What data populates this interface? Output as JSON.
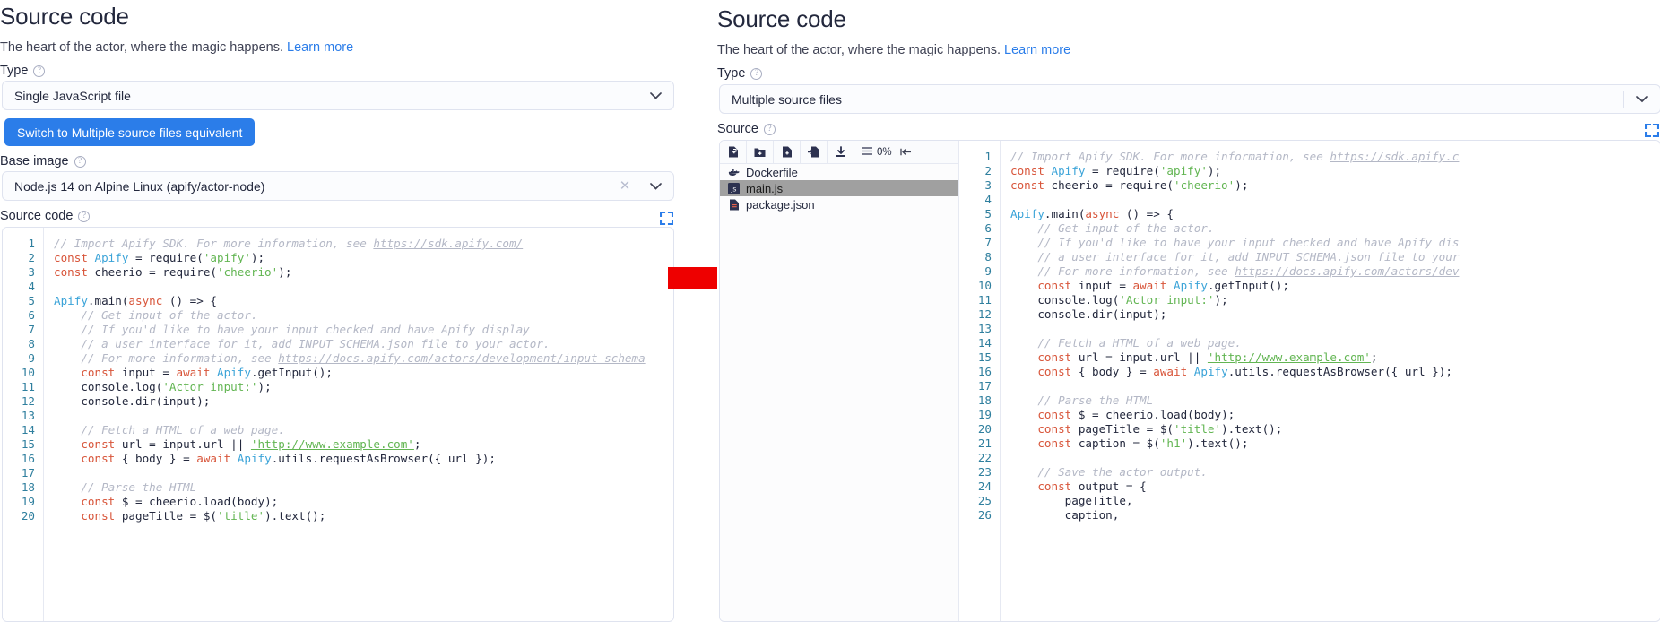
{
  "arrow": {
    "name": "red-right-arrow",
    "color": "#ee0000"
  },
  "left_panel": {
    "title": "Source code",
    "subtitle": "The heart of the actor, where the magic happens.",
    "learn_more": "Learn more",
    "type_label": "Type",
    "type_value": "Single JavaScript file",
    "switch_button": "Switch to Multiple source files equivalent",
    "base_image_label": "Base image",
    "base_image_value": "Node.js 14 on Alpine Linux (apify/actor-node)",
    "source_code_label": "Source code",
    "help_glyph": "?",
    "expand_icon": "expand-icon",
    "code": {
      "first_line": 1,
      "lines": [
        [
          {
            "t": "cmt",
            "v": "// Import Apify SDK. For more information, see "
          },
          {
            "t": "url",
            "v": "https://sdk.apify.com/"
          }
        ],
        [
          {
            "t": "kw",
            "v": "const"
          },
          {
            "t": "txt",
            "v": " "
          },
          {
            "t": "cls",
            "v": "Apify"
          },
          {
            "t": "txt",
            "v": " = require("
          },
          {
            "t": "str",
            "v": "'apify'"
          },
          {
            "t": "txt",
            "v": ");"
          }
        ],
        [
          {
            "t": "kw",
            "v": "const"
          },
          {
            "t": "txt",
            "v": " cheerio = require("
          },
          {
            "t": "str",
            "v": "'cheerio'"
          },
          {
            "t": "txt",
            "v": ");"
          }
        ],
        [],
        [
          {
            "t": "cls",
            "v": "Apify"
          },
          {
            "t": "txt",
            "v": ".main("
          },
          {
            "t": "kw",
            "v": "async"
          },
          {
            "t": "txt",
            "v": " () => {"
          }
        ],
        [
          {
            "t": "cmt",
            "v": "    // Get input of the actor."
          }
        ],
        [
          {
            "t": "cmt",
            "v": "    // If you'd like to have your input checked and have Apify display"
          }
        ],
        [
          {
            "t": "cmt",
            "v": "    // a user interface for it, add INPUT_SCHEMA.json file to your actor."
          }
        ],
        [
          {
            "t": "cmt",
            "v": "    // For more information, see "
          },
          {
            "t": "url",
            "v": "https://docs.apify.com/actors/development/input-schema"
          }
        ],
        [
          {
            "t": "txt",
            "v": "    "
          },
          {
            "t": "kw",
            "v": "const"
          },
          {
            "t": "txt",
            "v": " input = "
          },
          {
            "t": "kw",
            "v": "await"
          },
          {
            "t": "txt",
            "v": " "
          },
          {
            "t": "cls",
            "v": "Apify"
          },
          {
            "t": "txt",
            "v": ".getInput();"
          }
        ],
        [
          {
            "t": "txt",
            "v": "    console.log("
          },
          {
            "t": "str",
            "v": "'Actor input:'"
          },
          {
            "t": "txt",
            "v": ");"
          }
        ],
        [
          {
            "t": "txt",
            "v": "    console.dir(input);"
          }
        ],
        [],
        [
          {
            "t": "cmt",
            "v": "    // Fetch a HTML of a web page."
          }
        ],
        [
          {
            "t": "txt",
            "v": "    "
          },
          {
            "t": "kw",
            "v": "const"
          },
          {
            "t": "txt",
            "v": " url = input.url || "
          },
          {
            "t": "strurl",
            "v": "'http://www.example.com'"
          },
          {
            "t": "txt",
            "v": ";"
          }
        ],
        [
          {
            "t": "txt",
            "v": "    "
          },
          {
            "t": "kw",
            "v": "const"
          },
          {
            "t": "txt",
            "v": " { body } = "
          },
          {
            "t": "kw",
            "v": "await"
          },
          {
            "t": "txt",
            "v": " "
          },
          {
            "t": "cls",
            "v": "Apify"
          },
          {
            "t": "txt",
            "v": ".utils.requestAsBrowser({ url });"
          }
        ],
        [],
        [
          {
            "t": "cmt",
            "v": "    // Parse the HTML"
          }
        ],
        [
          {
            "t": "txt",
            "v": "    "
          },
          {
            "t": "kw",
            "v": "const"
          },
          {
            "t": "txt",
            "v": " $ = cheerio.load(body);"
          }
        ],
        [
          {
            "t": "txt",
            "v": "    "
          },
          {
            "t": "kw",
            "v": "const"
          },
          {
            "t": "txt",
            "v": " pageTitle = $("
          },
          {
            "t": "str",
            "v": "'title'"
          },
          {
            "t": "txt",
            "v": ").text();"
          }
        ]
      ]
    }
  },
  "right_panel": {
    "title": "Source code",
    "subtitle": "The heart of the actor, where the magic happens.",
    "learn_more": "Learn more",
    "type_label": "Type",
    "type_value": "Multiple source files",
    "source_label": "Source",
    "help_glyph": "?",
    "expand_icon": "expand-icon",
    "toolbar": {
      "buttons": [
        {
          "name": "new-file-icon",
          "title": "New file"
        },
        {
          "name": "new-folder-icon",
          "title": "New folder"
        },
        {
          "name": "upload-file-icon",
          "title": "Upload file"
        },
        {
          "name": "import-file-icon",
          "title": "Import"
        },
        {
          "name": "download-icon",
          "title": "Download"
        }
      ],
      "percent": "0%",
      "list-icon": "list-icon",
      "collapse-icon": "collapse-left-icon"
    },
    "files": [
      {
        "name": "Dockerfile",
        "icon": "docker-icon",
        "selected": false
      },
      {
        "name": "main.js",
        "icon": "js-icon",
        "selected": true
      },
      {
        "name": "package.json",
        "icon": "package-icon",
        "selected": false
      }
    ],
    "code": {
      "first_line": 1,
      "lines": [
        [
          {
            "t": "cmt",
            "v": "// Import Apify SDK. For more information, see "
          },
          {
            "t": "url",
            "v": "https://sdk.apify.c"
          }
        ],
        [
          {
            "t": "kw",
            "v": "const"
          },
          {
            "t": "txt",
            "v": " "
          },
          {
            "t": "cls",
            "v": "Apify"
          },
          {
            "t": "txt",
            "v": " = require("
          },
          {
            "t": "str",
            "v": "'apify'"
          },
          {
            "t": "txt",
            "v": ");"
          }
        ],
        [
          {
            "t": "kw",
            "v": "const"
          },
          {
            "t": "txt",
            "v": " cheerio = require("
          },
          {
            "t": "str",
            "v": "'cheerio'"
          },
          {
            "t": "txt",
            "v": ");"
          }
        ],
        [],
        [
          {
            "t": "cls",
            "v": "Apify"
          },
          {
            "t": "txt",
            "v": ".main("
          },
          {
            "t": "kw",
            "v": "async"
          },
          {
            "t": "txt",
            "v": " () => {"
          }
        ],
        [
          {
            "t": "cmt",
            "v": "    // Get input of the actor."
          }
        ],
        [
          {
            "t": "cmt",
            "v": "    // If you'd like to have your input checked and have Apify dis"
          }
        ],
        [
          {
            "t": "cmt",
            "v": "    // a user interface for it, add INPUT_SCHEMA.json file to your"
          }
        ],
        [
          {
            "t": "cmt",
            "v": "    // For more information, see "
          },
          {
            "t": "url",
            "v": "https://docs.apify.com/actors/dev"
          }
        ],
        [
          {
            "t": "txt",
            "v": "    "
          },
          {
            "t": "kw",
            "v": "const"
          },
          {
            "t": "txt",
            "v": " input = "
          },
          {
            "t": "kw",
            "v": "await"
          },
          {
            "t": "txt",
            "v": " "
          },
          {
            "t": "cls",
            "v": "Apify"
          },
          {
            "t": "txt",
            "v": ".getInput();"
          }
        ],
        [
          {
            "t": "txt",
            "v": "    console.log("
          },
          {
            "t": "str",
            "v": "'Actor input:'"
          },
          {
            "t": "txt",
            "v": ");"
          }
        ],
        [
          {
            "t": "txt",
            "v": "    console.dir(input);"
          }
        ],
        [],
        [
          {
            "t": "cmt",
            "v": "    // Fetch a HTML of a web page."
          }
        ],
        [
          {
            "t": "txt",
            "v": "    "
          },
          {
            "t": "kw",
            "v": "const"
          },
          {
            "t": "txt",
            "v": " url = input.url || "
          },
          {
            "t": "strurl",
            "v": "'http://www.example.com'"
          },
          {
            "t": "txt",
            "v": ";"
          }
        ],
        [
          {
            "t": "txt",
            "v": "    "
          },
          {
            "t": "kw",
            "v": "const"
          },
          {
            "t": "txt",
            "v": " { body } = "
          },
          {
            "t": "kw",
            "v": "await"
          },
          {
            "t": "txt",
            "v": " "
          },
          {
            "t": "cls",
            "v": "Apify"
          },
          {
            "t": "txt",
            "v": ".utils.requestAsBrowser({ url });"
          }
        ],
        [],
        [
          {
            "t": "cmt",
            "v": "    // Parse the HTML"
          }
        ],
        [
          {
            "t": "txt",
            "v": "    "
          },
          {
            "t": "kw",
            "v": "const"
          },
          {
            "t": "txt",
            "v": " $ = cheerio.load(body);"
          }
        ],
        [
          {
            "t": "txt",
            "v": "    "
          },
          {
            "t": "kw",
            "v": "const"
          },
          {
            "t": "txt",
            "v": " pageTitle = $("
          },
          {
            "t": "str",
            "v": "'title'"
          },
          {
            "t": "txt",
            "v": ").text();"
          }
        ],
        [
          {
            "t": "txt",
            "v": "    "
          },
          {
            "t": "kw",
            "v": "const"
          },
          {
            "t": "txt",
            "v": " caption = $("
          },
          {
            "t": "str",
            "v": "'h1'"
          },
          {
            "t": "txt",
            "v": ").text();"
          }
        ],
        [],
        [
          {
            "t": "cmt",
            "v": "    // Save the actor output."
          }
        ],
        [
          {
            "t": "txt",
            "v": "    "
          },
          {
            "t": "kw",
            "v": "const"
          },
          {
            "t": "txt",
            "v": " output = {"
          }
        ],
        [
          {
            "t": "txt",
            "v": "        pageTitle,"
          }
        ],
        [
          {
            "t": "txt",
            "v": "        caption,"
          }
        ]
      ]
    }
  }
}
